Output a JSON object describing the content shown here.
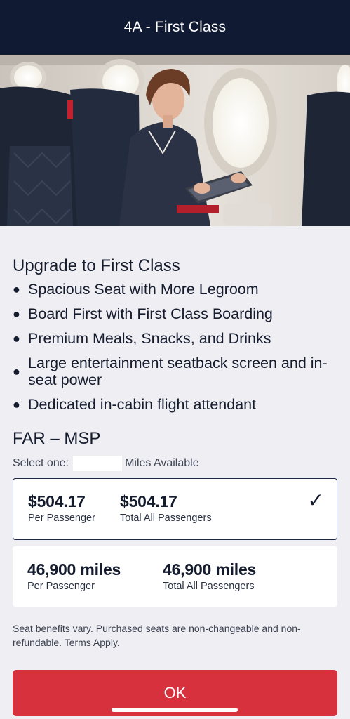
{
  "header": {
    "title": "4A - First Class"
  },
  "upgrade": {
    "title": "Upgrade to First Class",
    "benefits": [
      "Spacious Seat with More Legroom",
      "Board First with First Class Boarding",
      "Premium Meals, Snacks, and Drinks",
      "Large entertainment seatback screen and in-seat power",
      "Dedicated in-cabin flight attendant"
    ]
  },
  "route": "FAR – MSP",
  "select": {
    "label": "Select one:",
    "miles_available_label": "Miles Available"
  },
  "options": [
    {
      "selected": true,
      "per_passenger_value": "$504.17",
      "per_passenger_label": "Per Passenger",
      "total_value": "$504.17",
      "total_label": "Total All Passengers"
    },
    {
      "selected": false,
      "per_passenger_value": "46,900 miles",
      "per_passenger_label": "Per Passenger",
      "total_value": "46,900 miles",
      "total_label": "Total All Passengers"
    }
  ],
  "disclaimer": "Seat benefits vary. Purchased seats are non-changeable and non-refundable. Terms Apply.",
  "ok_button": {
    "label": "OK"
  },
  "icons": {
    "selected_check": "checkmark-icon"
  },
  "colors": {
    "header_bg": "#101a33",
    "accent": "#d7313e",
    "page_bg": "#efeef3"
  }
}
